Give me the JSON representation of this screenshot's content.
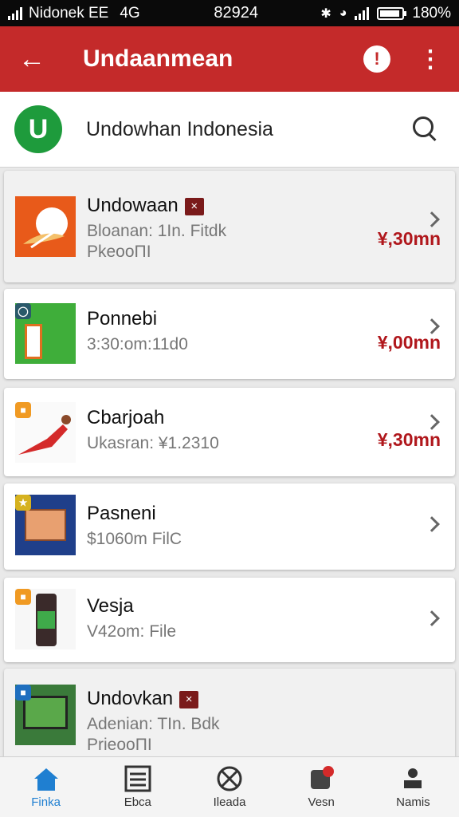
{
  "status_bar": {
    "carrier": "Nidonek EE",
    "network": "4G",
    "time": "82924",
    "battery": "180%"
  },
  "app_bar": {
    "back_label": "←",
    "title": "Undaanmean",
    "info_label": "!",
    "more_label": "⋮"
  },
  "header": {
    "logo_letter": "U",
    "brand_name": "Undowhan Indonesia"
  },
  "items": [
    {
      "title": "Undowaan",
      "badge": "×",
      "sub1": "Bloanan: 1In. Fitdk",
      "sub2": "PkeooΠI",
      "price": "¥,30mn"
    },
    {
      "title": "Ponnebi",
      "badge": "",
      "sub1": "3:30:om:11d0",
      "sub2": "",
      "price": "¥,00mn"
    },
    {
      "title": "Cbarjoah",
      "badge": "",
      "sub1": "Ukasran: ¥1.2310",
      "sub2": "",
      "price": "¥,30mn"
    },
    {
      "title": "Pasneni",
      "badge": "",
      "sub1": "$1060m FilC",
      "sub2": "",
      "price": ""
    },
    {
      "title": "Vesja",
      "badge": "",
      "sub1": "V42om: File",
      "sub2": "",
      "price": ""
    },
    {
      "title": "Undovkan",
      "badge": "×",
      "sub1": "Adenian: TIn. Bdk",
      "sub2": "PrieooΠI",
      "price": ""
    }
  ],
  "nav": [
    {
      "label": "Finka",
      "icon": "home-icon"
    },
    {
      "label": "Ebca",
      "icon": "list-icon"
    },
    {
      "label": "Ileada",
      "icon": "cancel-circle-icon"
    },
    {
      "label": "Vesn",
      "icon": "notification-icon"
    },
    {
      "label": "Namis",
      "icon": "profile-icon"
    }
  ],
  "colors": {
    "app_bar": "#c42a2a",
    "price": "#b0171c",
    "brand_logo": "#1e9b3c",
    "active_nav": "#1f7fd1"
  }
}
